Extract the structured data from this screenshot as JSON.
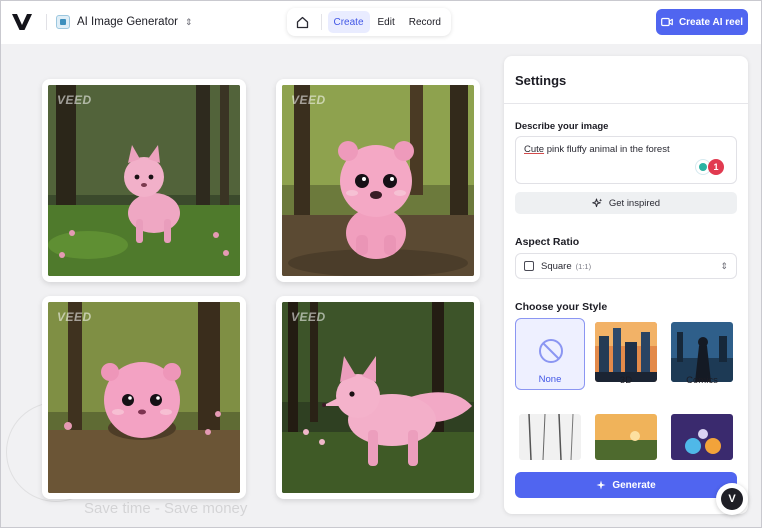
{
  "header": {
    "project_name": "AI Image Generator",
    "modes": [
      "Create",
      "Edit",
      "Record"
    ],
    "active_mode": "Create",
    "cta_label": "Create AI reel"
  },
  "gallery": {
    "watermark": "VEED",
    "ghost_text": "Save time - Save money"
  },
  "settings": {
    "title": "Settings",
    "prompt_label": "Describe your image",
    "prompt_first_word": "Cute",
    "prompt_rest": " pink fluffy animal in the forest",
    "grammar_count": "1",
    "inspire_label": "Get inspired",
    "aspect_label": "Aspect Ratio",
    "aspect_value": "Square",
    "aspect_ratio": "(1:1)",
    "style_label": "Choose your Style",
    "styles": [
      "None",
      "3D",
      "Comics"
    ],
    "generate_label": "Generate"
  },
  "colors": {
    "accent": "#5065f0",
    "accent_light": "#e9ecff",
    "grammar_red": "#e13a50"
  }
}
